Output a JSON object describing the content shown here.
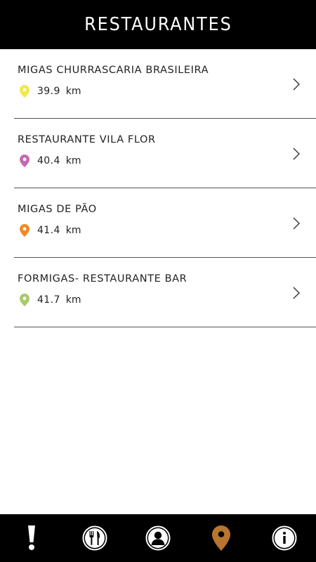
{
  "header": {
    "title": "RESTAURANTES"
  },
  "restaurants": [
    {
      "name": "MIGAS CHURRASCARIA BRASILEIRA",
      "distance": "39.9",
      "unit": "km",
      "pin_color": "#f4e84a",
      "icon": "location-pin-icon"
    },
    {
      "name": "RESTAURANTE VILA FLOR",
      "distance": "40.4",
      "unit": "km",
      "pin_color": "#c46ab0",
      "icon": "location-pin-icon"
    },
    {
      "name": "MIGAS DE PÃO",
      "distance": "41.4",
      "unit": "km",
      "pin_color": "#f08a24",
      "icon": "location-pin-icon"
    },
    {
      "name": "FORMIGAS- RESTAURANTE BAR",
      "distance": "41.7",
      "unit": "km",
      "pin_color": "#a9c96a",
      "icon": "location-pin-icon"
    }
  ],
  "tabbar": {
    "tabs": [
      {
        "icon": "exclamation-icon",
        "active": false
      },
      {
        "icon": "fork-knife-icon",
        "active": false
      },
      {
        "icon": "person-icon",
        "active": false
      },
      {
        "icon": "location-pin-icon",
        "active": true
      },
      {
        "icon": "info-icon",
        "active": false
      }
    ],
    "active_color": "#b8752e",
    "inactive_color": "#ffffff"
  }
}
